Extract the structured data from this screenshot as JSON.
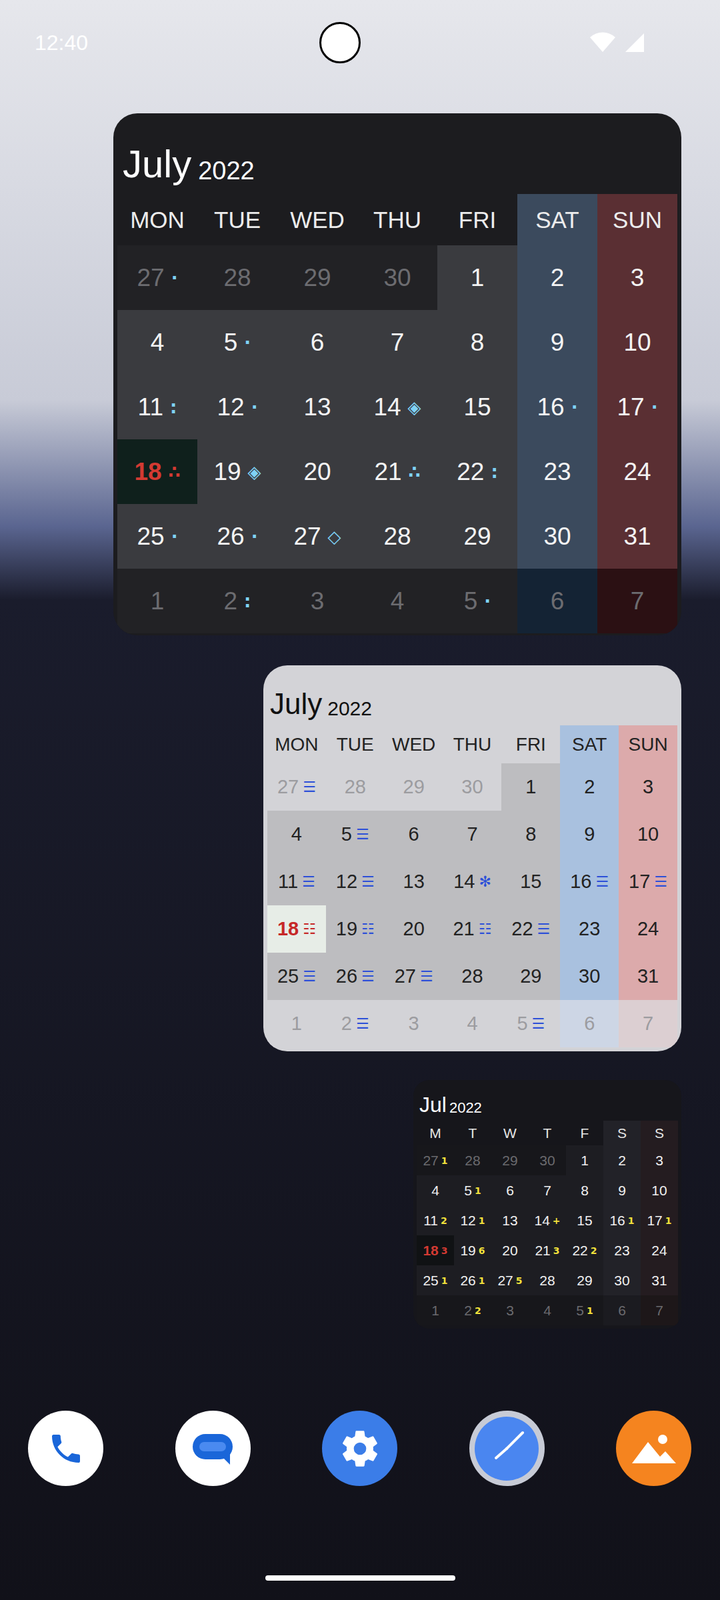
{
  "status_bar": {
    "time": "12:40"
  },
  "widgets": [
    {
      "name": "large",
      "month": "July",
      "year": "2022",
      "weekdays": [
        {
          "label": "MON",
          "kind": "weekday"
        },
        {
          "label": "TUE",
          "kind": "weekday"
        },
        {
          "label": "WED",
          "kind": "weekday"
        },
        {
          "label": "THU",
          "kind": "weekday"
        },
        {
          "label": "FRI",
          "kind": "weekday"
        },
        {
          "label": "SAT",
          "kind": "saturday"
        },
        {
          "label": "SUN",
          "kind": "sunday"
        }
      ],
      "weeks": [
        [
          {
            "day": "27",
            "muted": true,
            "today": false,
            "marker": "·"
          },
          {
            "day": "28",
            "muted": true,
            "today": false,
            "marker": ""
          },
          {
            "day": "29",
            "muted": true,
            "today": false,
            "marker": ""
          },
          {
            "day": "30",
            "muted": true,
            "today": false,
            "marker": ""
          },
          {
            "day": "1",
            "muted": false,
            "today": false,
            "marker": ""
          },
          {
            "day": "2",
            "muted": false,
            "today": false,
            "marker": ""
          },
          {
            "day": "3",
            "muted": false,
            "today": false,
            "marker": ""
          }
        ],
        [
          {
            "day": "4",
            "muted": false,
            "today": false,
            "marker": ""
          },
          {
            "day": "5",
            "muted": false,
            "today": false,
            "marker": "·"
          },
          {
            "day": "6",
            "muted": false,
            "today": false,
            "marker": ""
          },
          {
            "day": "7",
            "muted": false,
            "today": false,
            "marker": ""
          },
          {
            "day": "8",
            "muted": false,
            "today": false,
            "marker": ""
          },
          {
            "day": "9",
            "muted": false,
            "today": false,
            "marker": ""
          },
          {
            "day": "10",
            "muted": false,
            "today": false,
            "marker": ""
          }
        ],
        [
          {
            "day": "11",
            "muted": false,
            "today": false,
            "marker": ":"
          },
          {
            "day": "12",
            "muted": false,
            "today": false,
            "marker": "·"
          },
          {
            "day": "13",
            "muted": false,
            "today": false,
            "marker": ""
          },
          {
            "day": "14",
            "muted": false,
            "today": false,
            "marker": "◈"
          },
          {
            "day": "15",
            "muted": false,
            "today": false,
            "marker": ""
          },
          {
            "day": "16",
            "muted": false,
            "today": false,
            "marker": "·"
          },
          {
            "day": "17",
            "muted": false,
            "today": false,
            "marker": "·"
          }
        ],
        [
          {
            "day": "18",
            "muted": false,
            "today": true,
            "marker": "∴"
          },
          {
            "day": "19",
            "muted": false,
            "today": false,
            "marker": "◈"
          },
          {
            "day": "20",
            "muted": false,
            "today": false,
            "marker": ""
          },
          {
            "day": "21",
            "muted": false,
            "today": false,
            "marker": "∴"
          },
          {
            "day": "22",
            "muted": false,
            "today": false,
            "marker": ":"
          },
          {
            "day": "23",
            "muted": false,
            "today": false,
            "marker": ""
          },
          {
            "day": "24",
            "muted": false,
            "today": false,
            "marker": ""
          }
        ],
        [
          {
            "day": "25",
            "muted": false,
            "today": false,
            "marker": "·"
          },
          {
            "day": "26",
            "muted": false,
            "today": false,
            "marker": "·"
          },
          {
            "day": "27",
            "muted": false,
            "today": false,
            "marker": "◇"
          },
          {
            "day": "28",
            "muted": false,
            "today": false,
            "marker": ""
          },
          {
            "day": "29",
            "muted": false,
            "today": false,
            "marker": ""
          },
          {
            "day": "30",
            "muted": false,
            "today": false,
            "marker": ""
          },
          {
            "day": "31",
            "muted": false,
            "today": false,
            "marker": ""
          }
        ],
        [
          {
            "day": "1",
            "muted": true,
            "today": false,
            "marker": ""
          },
          {
            "day": "2",
            "muted": true,
            "today": false,
            "marker": ":"
          },
          {
            "day": "3",
            "muted": true,
            "today": false,
            "marker": ""
          },
          {
            "day": "4",
            "muted": true,
            "today": false,
            "marker": ""
          },
          {
            "day": "5",
            "muted": true,
            "today": false,
            "marker": "·"
          },
          {
            "day": "6",
            "muted": true,
            "today": false,
            "marker": ""
          },
          {
            "day": "7",
            "muted": true,
            "today": false,
            "marker": ""
          }
        ]
      ]
    },
    {
      "name": "medium",
      "month": "July",
      "year": "2022",
      "weekdays": [
        {
          "label": "MON",
          "kind": "weekday"
        },
        {
          "label": "TUE",
          "kind": "weekday"
        },
        {
          "label": "WED",
          "kind": "weekday"
        },
        {
          "label": "THU",
          "kind": "weekday"
        },
        {
          "label": "FRI",
          "kind": "weekday"
        },
        {
          "label": "SAT",
          "kind": "saturday"
        },
        {
          "label": "SUN",
          "kind": "sunday"
        }
      ],
      "weeks": [
        [
          {
            "day": "27",
            "muted": true,
            "today": false,
            "marker": "☰"
          },
          {
            "day": "28",
            "muted": true,
            "today": false,
            "marker": ""
          },
          {
            "day": "29",
            "muted": true,
            "today": false,
            "marker": ""
          },
          {
            "day": "30",
            "muted": true,
            "today": false,
            "marker": ""
          },
          {
            "day": "1",
            "muted": false,
            "today": false,
            "marker": ""
          },
          {
            "day": "2",
            "muted": false,
            "today": false,
            "marker": ""
          },
          {
            "day": "3",
            "muted": false,
            "today": false,
            "marker": ""
          }
        ],
        [
          {
            "day": "4",
            "muted": false,
            "today": false,
            "marker": ""
          },
          {
            "day": "5",
            "muted": false,
            "today": false,
            "marker": "☰"
          },
          {
            "day": "6",
            "muted": false,
            "today": false,
            "marker": ""
          },
          {
            "day": "7",
            "muted": false,
            "today": false,
            "marker": ""
          },
          {
            "day": "8",
            "muted": false,
            "today": false,
            "marker": ""
          },
          {
            "day": "9",
            "muted": false,
            "today": false,
            "marker": ""
          },
          {
            "day": "10",
            "muted": false,
            "today": false,
            "marker": ""
          }
        ],
        [
          {
            "day": "11",
            "muted": false,
            "today": false,
            "marker": "☰"
          },
          {
            "day": "12",
            "muted": false,
            "today": false,
            "marker": "☰"
          },
          {
            "day": "13",
            "muted": false,
            "today": false,
            "marker": ""
          },
          {
            "day": "14",
            "muted": false,
            "today": false,
            "marker": "✻"
          },
          {
            "day": "15",
            "muted": false,
            "today": false,
            "marker": ""
          },
          {
            "day": "16",
            "muted": false,
            "today": false,
            "marker": "☰"
          },
          {
            "day": "17",
            "muted": false,
            "today": false,
            "marker": "☰"
          }
        ],
        [
          {
            "day": "18",
            "muted": false,
            "today": true,
            "marker": "☷"
          },
          {
            "day": "19",
            "muted": false,
            "today": false,
            "marker": "☷"
          },
          {
            "day": "20",
            "muted": false,
            "today": false,
            "marker": ""
          },
          {
            "day": "21",
            "muted": false,
            "today": false,
            "marker": "☷"
          },
          {
            "day": "22",
            "muted": false,
            "today": false,
            "marker": "☰"
          },
          {
            "day": "23",
            "muted": false,
            "today": false,
            "marker": ""
          },
          {
            "day": "24",
            "muted": false,
            "today": false,
            "marker": ""
          }
        ],
        [
          {
            "day": "25",
            "muted": false,
            "today": false,
            "marker": "☰"
          },
          {
            "day": "26",
            "muted": false,
            "today": false,
            "marker": "☰"
          },
          {
            "day": "27",
            "muted": false,
            "today": false,
            "marker": "☰"
          },
          {
            "day": "28",
            "muted": false,
            "today": false,
            "marker": ""
          },
          {
            "day": "29",
            "muted": false,
            "today": false,
            "marker": ""
          },
          {
            "day": "30",
            "muted": false,
            "today": false,
            "marker": ""
          },
          {
            "day": "31",
            "muted": false,
            "today": false,
            "marker": ""
          }
        ],
        [
          {
            "day": "1",
            "muted": true,
            "today": false,
            "marker": ""
          },
          {
            "day": "2",
            "muted": true,
            "today": false,
            "marker": "☰"
          },
          {
            "day": "3",
            "muted": true,
            "today": false,
            "marker": ""
          },
          {
            "day": "4",
            "muted": true,
            "today": false,
            "marker": ""
          },
          {
            "day": "5",
            "muted": true,
            "today": false,
            "marker": "☰"
          },
          {
            "day": "6",
            "muted": true,
            "today": false,
            "marker": ""
          },
          {
            "day": "7",
            "muted": true,
            "today": false,
            "marker": ""
          }
        ]
      ]
    },
    {
      "name": "small",
      "month": "Jul",
      "year": "2022",
      "weekdays": [
        {
          "label": "M",
          "kind": "weekday"
        },
        {
          "label": "T",
          "kind": "weekday"
        },
        {
          "label": "W",
          "kind": "weekday"
        },
        {
          "label": "T",
          "kind": "weekday"
        },
        {
          "label": "F",
          "kind": "weekday"
        },
        {
          "label": "S",
          "kind": "saturday"
        },
        {
          "label": "S",
          "kind": "sunday"
        }
      ],
      "weeks": [
        [
          {
            "day": "27",
            "muted": true,
            "today": false,
            "marker": "1"
          },
          {
            "day": "28",
            "muted": true,
            "today": false,
            "marker": ""
          },
          {
            "day": "29",
            "muted": true,
            "today": false,
            "marker": ""
          },
          {
            "day": "30",
            "muted": true,
            "today": false,
            "marker": ""
          },
          {
            "day": "1",
            "muted": false,
            "today": false,
            "marker": ""
          },
          {
            "day": "2",
            "muted": false,
            "today": false,
            "marker": ""
          },
          {
            "day": "3",
            "muted": false,
            "today": false,
            "marker": ""
          }
        ],
        [
          {
            "day": "4",
            "muted": false,
            "today": false,
            "marker": ""
          },
          {
            "day": "5",
            "muted": false,
            "today": false,
            "marker": "1"
          },
          {
            "day": "6",
            "muted": false,
            "today": false,
            "marker": ""
          },
          {
            "day": "7",
            "muted": false,
            "today": false,
            "marker": ""
          },
          {
            "day": "8",
            "muted": false,
            "today": false,
            "marker": ""
          },
          {
            "day": "9",
            "muted": false,
            "today": false,
            "marker": ""
          },
          {
            "day": "10",
            "muted": false,
            "today": false,
            "marker": ""
          }
        ],
        [
          {
            "day": "11",
            "muted": false,
            "today": false,
            "marker": "2"
          },
          {
            "day": "12",
            "muted": false,
            "today": false,
            "marker": "1"
          },
          {
            "day": "13",
            "muted": false,
            "today": false,
            "marker": ""
          },
          {
            "day": "14",
            "muted": false,
            "today": false,
            "marker": "+"
          },
          {
            "day": "15",
            "muted": false,
            "today": false,
            "marker": ""
          },
          {
            "day": "16",
            "muted": false,
            "today": false,
            "marker": "1"
          },
          {
            "day": "17",
            "muted": false,
            "today": false,
            "marker": "1"
          }
        ],
        [
          {
            "day": "18",
            "muted": false,
            "today": true,
            "marker": "3"
          },
          {
            "day": "19",
            "muted": false,
            "today": false,
            "marker": "6"
          },
          {
            "day": "20",
            "muted": false,
            "today": false,
            "marker": ""
          },
          {
            "day": "21",
            "muted": false,
            "today": false,
            "marker": "3"
          },
          {
            "day": "22",
            "muted": false,
            "today": false,
            "marker": "2"
          },
          {
            "day": "23",
            "muted": false,
            "today": false,
            "marker": ""
          },
          {
            "day": "24",
            "muted": false,
            "today": false,
            "marker": ""
          }
        ],
        [
          {
            "day": "25",
            "muted": false,
            "today": false,
            "marker": "1"
          },
          {
            "day": "26",
            "muted": false,
            "today": false,
            "marker": "1"
          },
          {
            "day": "27",
            "muted": false,
            "today": false,
            "marker": "5"
          },
          {
            "day": "28",
            "muted": false,
            "today": false,
            "marker": ""
          },
          {
            "day": "29",
            "muted": false,
            "today": false,
            "marker": ""
          },
          {
            "day": "30",
            "muted": false,
            "today": false,
            "marker": ""
          },
          {
            "day": "31",
            "muted": false,
            "today": false,
            "marker": ""
          }
        ],
        [
          {
            "day": "1",
            "muted": true,
            "today": false,
            "marker": ""
          },
          {
            "day": "2",
            "muted": true,
            "today": false,
            "marker": "2"
          },
          {
            "day": "3",
            "muted": true,
            "today": false,
            "marker": ""
          },
          {
            "day": "4",
            "muted": true,
            "today": false,
            "marker": ""
          },
          {
            "day": "5",
            "muted": true,
            "today": false,
            "marker": "1"
          },
          {
            "day": "6",
            "muted": true,
            "today": false,
            "marker": ""
          },
          {
            "day": "7",
            "muted": true,
            "today": false,
            "marker": ""
          }
        ]
      ]
    }
  ]
}
